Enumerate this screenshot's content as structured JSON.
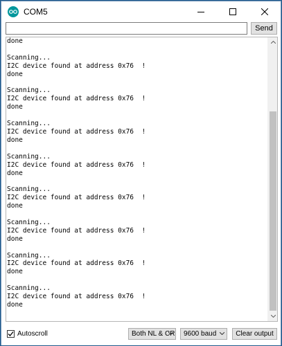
{
  "window": {
    "title": "COM5",
    "accent": "#00979c"
  },
  "input": {
    "value": "",
    "send_label": "Send"
  },
  "output": {
    "lines": [
      "done",
      "",
      "Scanning...",
      "I2C device found at address 0x76  !",
      "done",
      "",
      "Scanning...",
      "I2C device found at address 0x76  !",
      "done",
      "",
      "Scanning...",
      "I2C device found at address 0x76  !",
      "done",
      "",
      "Scanning...",
      "I2C device found at address 0x76  !",
      "done",
      "",
      "Scanning...",
      "I2C device found at address 0x76  !",
      "done",
      "",
      "Scanning...",
      "I2C device found at address 0x76  !",
      "done",
      "",
      "Scanning...",
      "I2C device found at address 0x76  !",
      "done",
      "",
      "Scanning...",
      "I2C device found at address 0x76  !",
      "done"
    ]
  },
  "footer": {
    "autoscroll_label": "Autoscroll",
    "autoscroll_checked": true,
    "line_ending": "Both NL & CR",
    "baud": "9600 baud",
    "clear_label": "Clear output"
  }
}
